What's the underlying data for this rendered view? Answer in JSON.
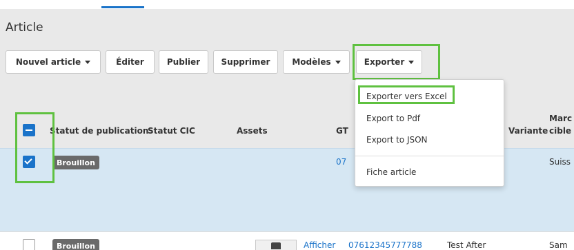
{
  "page": {
    "title": "Article"
  },
  "toolbar": {
    "new_article": "Nouvel article",
    "edit": "Éditer",
    "publish": "Publier",
    "delete": "Supprimer",
    "models": "Modèles",
    "export": "Exporter"
  },
  "export_menu": {
    "items": [
      "Exporter vers Excel",
      "Export to Pdf",
      "Export to JSON",
      "Fiche article"
    ]
  },
  "table": {
    "headers": {
      "status": "Statut de publication",
      "cic": "Statut CIC",
      "assets": "Assets",
      "gtin": "GT",
      "variant": "Variante",
      "market_line1": "Marc",
      "market_line2": "cible"
    },
    "rows": [
      {
        "checked": true,
        "status": "Brouillon",
        "gtin": "07",
        "market": "Suiss"
      },
      {
        "checked": false,
        "status": "Brouillon",
        "assets_link": "Afficher",
        "gtin": "07612345777788",
        "variant": "Test After",
        "market": "Sam"
      }
    ]
  },
  "colors": {
    "accent": "#1a73c9",
    "highlight": "#5fc140",
    "row_selected": "#d6e7f3",
    "badge": "#6a6a6a"
  }
}
